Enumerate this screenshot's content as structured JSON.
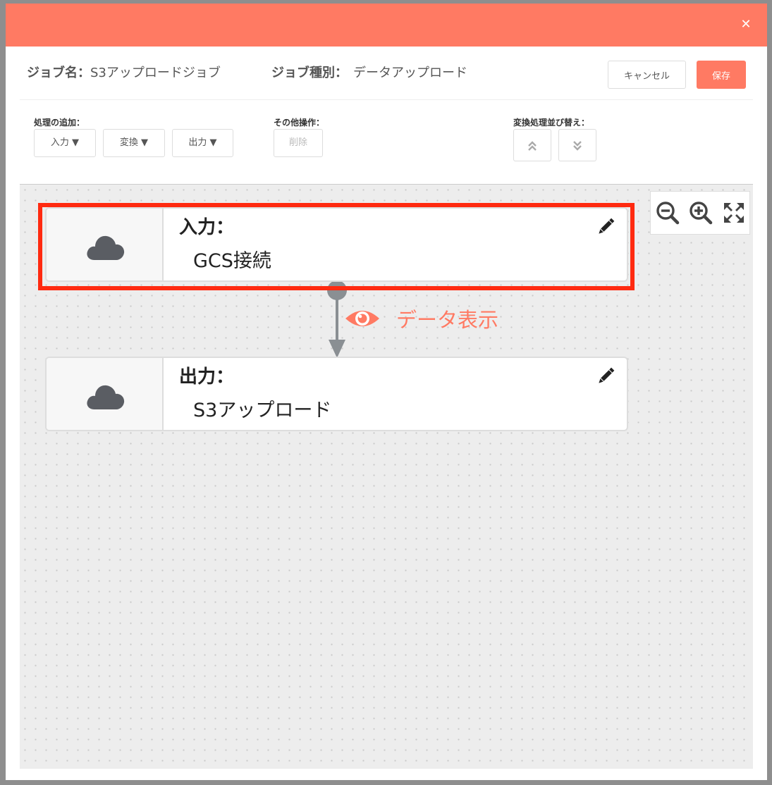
{
  "modal": {
    "close_icon": "✕"
  },
  "job": {
    "name_label": "ジョブ名：",
    "name_value": "S3アップロードジョブ",
    "type_label": "ジョブ種別：",
    "type_value": "データアップロード"
  },
  "actions": {
    "cancel": "キャンセル",
    "save": "保存"
  },
  "toolbar": {
    "add_label": "処理の追加：",
    "input_btn": "入力 ▼",
    "transform_btn": "変換 ▼",
    "output_btn": "出力 ▼",
    "other_label": "その他操作：",
    "delete_btn": "削除",
    "reorder_label": "変換処理並び替え："
  },
  "nodes": [
    {
      "kind": "入力：",
      "name": "GCS接続",
      "icon": "cloud-icon"
    },
    {
      "kind": "出力：",
      "name": "S3アップロード",
      "icon": "cloud-icon"
    }
  ],
  "connector": {
    "label": "データ表示",
    "icon": "eye-icon"
  },
  "colors": {
    "accent": "#ff7a63",
    "highlight": "#ff2a10"
  }
}
